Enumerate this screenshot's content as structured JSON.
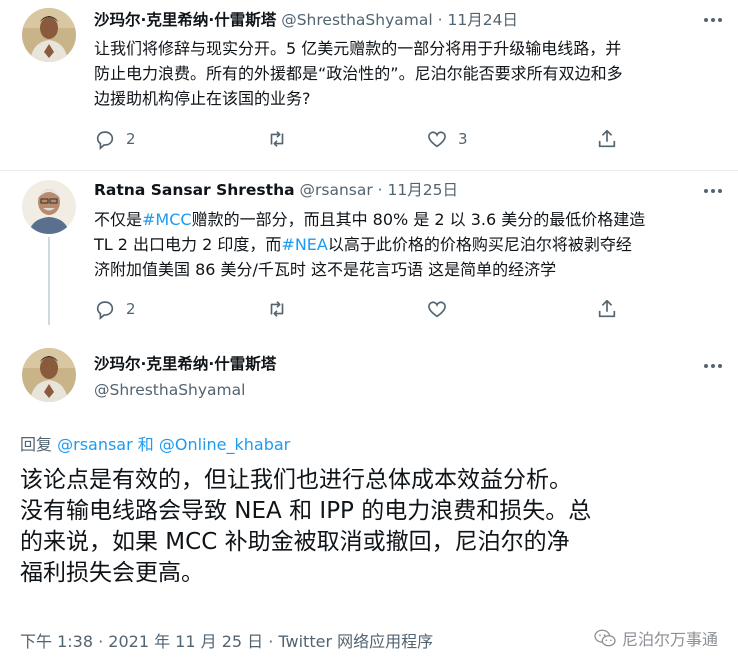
{
  "tweets": [
    {
      "name": "沙玛尔·克里希纳·什雷斯塔",
      "handle": "@ShresthaShyamal",
      "dot": "·",
      "date": "11月24日",
      "text_lines": [
        "让我们将修辞与现实分开。5 亿美元赠款的一部分将用于升级输电线路，并",
        "防止电力浪费。所有的外援都是“政治性的”。尼泊尔能否要求所有双边和多",
        "边援助机构停止在该国的业务?"
      ],
      "reply_count": "2",
      "retweet_count": "",
      "like_count": "3",
      "avatar_icon": "avatar-man-namaste"
    },
    {
      "name": "Ratna Sansar Shrestha",
      "handle": "@rsansar",
      "dot": "·",
      "date": "11月25日",
      "line1_a": "不仅是",
      "line1_tag": "#MCC",
      "line1_b": "赠款的一部分，而且其中 80% 是 2 以 3.6 美分的最低价格建造",
      "line2_a": "TL 2 出口电力 2 印度，而",
      "line2_tag": "#NEA",
      "line2_b": "以高于此价格的价格购买尼泊尔将被剥夺经",
      "line3": "济附加值美国 86 美分/千瓦时 这不是花言巧语 这是简单的经济学",
      "reply_count": "2",
      "retweet_count": "",
      "like_count": "",
      "avatar_icon": "avatar-elderly-man"
    }
  ],
  "main_tweet": {
    "name": "沙玛尔·克里希纳·什雷斯塔",
    "handle": "@ShresthaShyamal",
    "reply_prefix": "回复",
    "mention1": "@rsansar",
    "reply_and": "和",
    "mention2": "@Online_khabar",
    "text_lines": [
      "该论点是有效的，但让我们也进行总体成本效益分析。",
      "没有输电线路会导致 NEA 和 IPP 的电力浪费和损失。总",
      "的来说，如果 MCC 补助金被取消或撤回，尼泊尔的净",
      "福利损失会更高。"
    ],
    "footer": "下午 1:38 · 2021 年 11 月 25 日 · Twitter 网络应用程序",
    "avatar_icon": "avatar-man-namaste"
  },
  "watermark": {
    "text": "尼泊尔万事通",
    "icon": "wechat-icon"
  },
  "colors": {
    "link": "#1d9bf0",
    "muted": "#536471",
    "text": "#0f1419",
    "thread_line": "#cfd9de"
  }
}
